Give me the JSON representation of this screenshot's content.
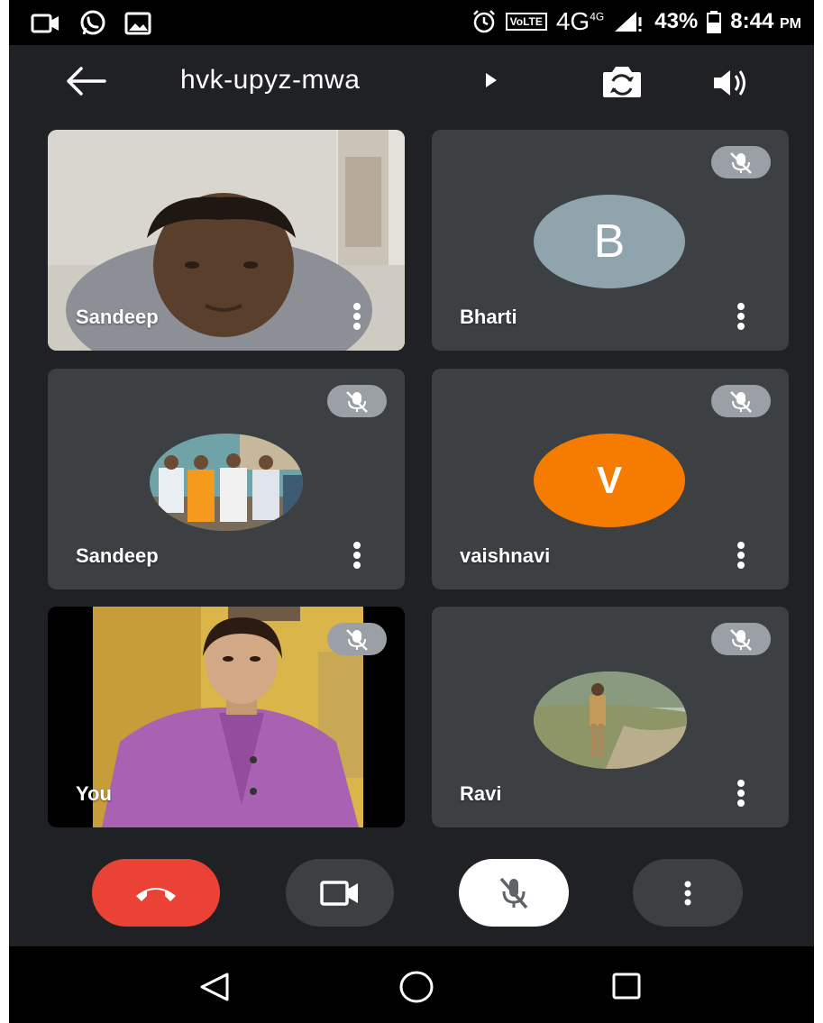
{
  "status_bar": {
    "icons_left": [
      "video-notification-icon",
      "whatsapp-icon",
      "gallery-icon"
    ],
    "volte": "VoLTE",
    "network": "4G",
    "network_sup": "4G",
    "battery": "43%",
    "time": "8:44",
    "time_suffix": "PM"
  },
  "header": {
    "meeting_code": "hvk-upyz-mwa",
    "icons": [
      "back-arrow-icon",
      "caret-right-icon",
      "switch-camera-icon",
      "speaker-icon"
    ]
  },
  "participants": [
    {
      "name": "Sandeep",
      "video": "camera",
      "muted": false
    },
    {
      "name": "Bharti",
      "avatar_letter": "B",
      "avatar_color": "#90a4ae",
      "muted": true
    },
    {
      "name": "Sandeep",
      "video": "group-photo-avatar",
      "muted": true
    },
    {
      "name": "vaishnavi",
      "avatar_letter": "V",
      "avatar_color": "#f57c00",
      "muted": true
    },
    {
      "name": "You",
      "video": "camera",
      "muted": true
    },
    {
      "name": "Ravi",
      "video": "photo-avatar",
      "muted": true
    }
  ],
  "controls": {
    "icons": [
      "end-call-icon",
      "video-icon",
      "mic-off-icon",
      "more-icon"
    ],
    "end_color": "#ea4335"
  },
  "colors": {
    "background": "#202124",
    "tile": "#3c4043",
    "mute_badge": "#9aa0a6"
  }
}
